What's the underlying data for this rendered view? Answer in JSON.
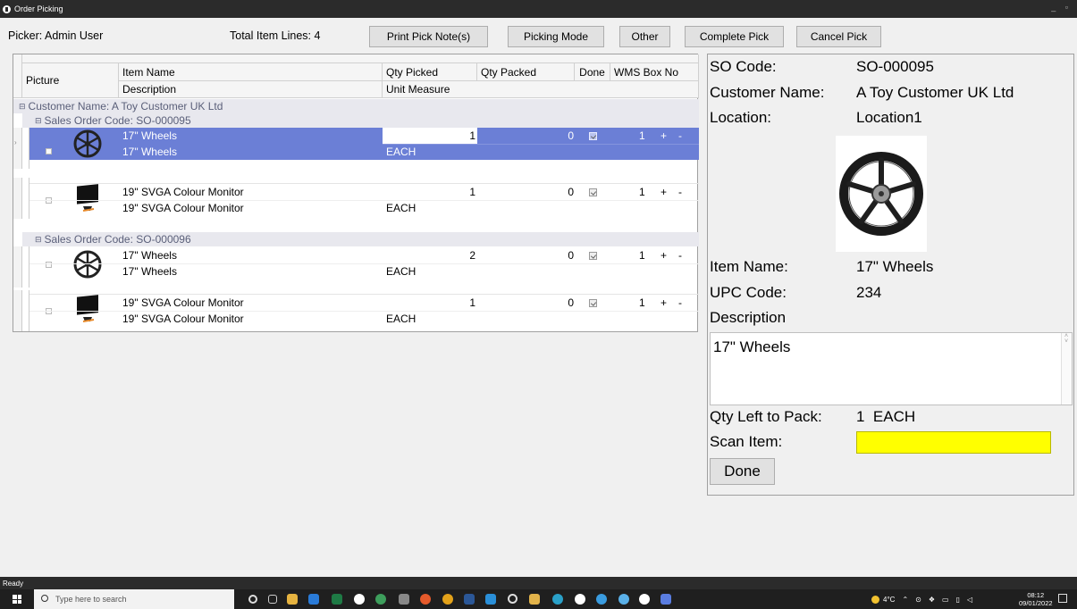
{
  "window": {
    "title": "Order Picking",
    "controls": "_  ▫"
  },
  "toolbar": {
    "picker_label": "Picker: Admin User",
    "total_lines": "Total Item Lines: 4",
    "print_pick_notes": "Print Pick Note(s)",
    "picking_mode": "Picking Mode",
    "other": "Other",
    "complete_pick": "Complete Pick",
    "cancel_pick": "Cancel Pick"
  },
  "grid": {
    "headers": {
      "picture": "Picture",
      "item_name": "Item Name",
      "description": "Description",
      "qty_picked": "Qty Picked",
      "unit_measure": "Unit Measure",
      "qty_packed": "Qty Packed",
      "done": "Done",
      "wms_box_no": "WMS Box No"
    },
    "customer_group": "Customer Name: A Toy Customer UK Ltd",
    "order_groups": [
      "Sales Order Code: SO-000095",
      "Sales Order Code: SO-000096"
    ],
    "rows": [
      {
        "icon": "wheel",
        "item_name": "17\" Wheels",
        "description": "17\" Wheels",
        "qty_picked": "1",
        "unit": "EACH",
        "qty_packed": "0",
        "wms_box": "1",
        "selected": true
      },
      {
        "icon": "monitor",
        "item_name": "19\" SVGA Colour Monitor",
        "description": "19\" SVGA Colour Monitor",
        "qty_picked": "1",
        "unit": "EACH",
        "qty_packed": "0",
        "wms_box": "1",
        "selected": false
      },
      {
        "icon": "wheel",
        "item_name": "17\" Wheels",
        "description": "17\" Wheels",
        "qty_picked": "2",
        "unit": "EACH",
        "qty_packed": "0",
        "wms_box": "1",
        "selected": false
      },
      {
        "icon": "monitor",
        "item_name": "19\" SVGA Colour Monitor",
        "description": "19\" SVGA Colour Monitor",
        "qty_picked": "1",
        "unit": "EACH",
        "qty_packed": "0",
        "wms_box": "1",
        "selected": false
      }
    ],
    "plus": "+",
    "minus": "-"
  },
  "details": {
    "so_code_label": "SO Code:",
    "so_code_value": "SO-000095",
    "customer_label": "Customer Name:",
    "customer_value": "A Toy Customer UK Ltd",
    "location_label": "Location:",
    "location_value": "Location1",
    "item_name_label": "Item Name:",
    "item_name_value": "17\" Wheels",
    "upc_label": "UPC Code:",
    "upc_value": "234",
    "description_label": "Description",
    "description_value": "17\" Wheels",
    "qty_left_label": "Qty Left to Pack:",
    "qty_left_value": "1  EACH",
    "scan_label": "Scan Item:",
    "scan_value": "",
    "done_button": "Done"
  },
  "statusbar": {
    "text": "Ready"
  },
  "taskbar": {
    "search_placeholder": "Type here to search",
    "weather": "4°C",
    "time": "08:12",
    "date": "09/01/2022"
  },
  "colors": {
    "selection": "#6b7fd6",
    "scan_field": "#ffff00",
    "group_text": "#5a5f79"
  }
}
